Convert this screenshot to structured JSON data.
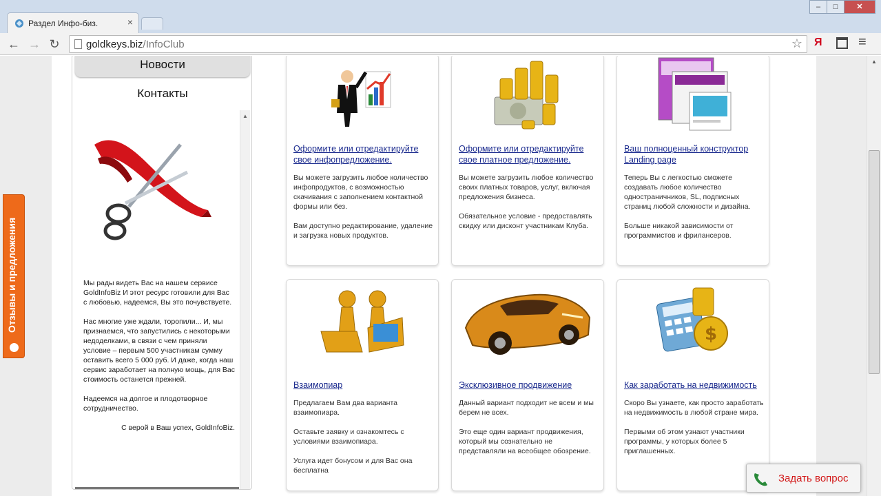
{
  "browser": {
    "tab_title": "Раздел Инфо-биз.",
    "tab_close": "×",
    "url_domain": "goldkeys.biz",
    "url_path": "/InfoClub",
    "back": "←",
    "forward": "→",
    "reload": "↻",
    "star": "☆",
    "yandex": "Я",
    "menu": "≡",
    "minimize": "–",
    "maximize": "□",
    "close": "✕"
  },
  "sidebar": {
    "news": "Новости",
    "contacts": "Контакты",
    "paragraphs": [
      "Мы рады видеть Вас на нашем сервисе GoldInfoBiz И этот ресурс готовили для Вас с любовью, надеемся, Вы это почувствуете.",
      "Нас многие уже ждали, торопили... И, мы признаемся, что запустились с некоторыми недоделками, в связи с чем приняли условие – первым 500 участникам сумму оставить всего 5 000 руб. И даже, когда наш сервис заработает на полную мощь, для Вас стоимость останется прежней.",
      "Надеемся на долгое и плодотворное сотрудничество."
    ],
    "signature": "С верой в Ваш успех, GoldInfoBiz."
  },
  "cards": [
    {
      "title": "Оформите или отредактируйте свое инфопредложение.",
      "paragraphs": [
        "Вы можете загрузить любое количество инфопродуктов, с возможностью скачивания с заполнением контактной формы или без.",
        "Вам доступно редактирование, удаление и загрузка новых продуктов."
      ]
    },
    {
      "title": "Оформите или отредактируйте свое платное предложение.",
      "paragraphs": [
        "Вы можете загрузить любое количество своих платных товаров, услуг, включая предложения бизнеса.",
        "Обязательное условие - предоставлять скидку или дисконт участникам Клуба."
      ]
    },
    {
      "title": "Ваш полноценный конструктор Landing page",
      "paragraphs": [
        "Теперь Вы с легкостью сможете создавать любое количество одностраничников, SL, подписных страниц любой сложности и дизайна.",
        "Больше никакой зависимости от программистов и фрилансеров."
      ]
    },
    {
      "title": "Взаимопиар",
      "paragraphs": [
        "Предлагаем Вам два варианта взаимопиара.",
        "Оставьте заявку и ознакомтесь с условиями взаимопиара.",
        "Услуга идет бонусом и для Вас она бесплатна"
      ]
    },
    {
      "title": "Эксклюзивное продвижение",
      "paragraphs": [
        "Данный вариант подходит не всем и мы берем не всех.",
        "Это еще один вариант продвижения, который мы сознательно не представляли на всеобщее обозрение."
      ]
    },
    {
      "title": "Как заработать на недвижимость",
      "paragraphs": [
        "Скоро Вы узнаете, как просто заработать на недвижимость в любой стране мира.",
        "Первыми об этом узнают участники программы, у которых более 5 приглашенных."
      ]
    }
  ],
  "feedback_tab": "Отзывы и предложения",
  "ask_button": "Задать вопрос",
  "colors": {
    "link": "#1a2a8e",
    "feedback": "#ee6a1a",
    "ask_text": "#d21818"
  },
  "icons": [
    "businessman-chart-icon",
    "gold-coins-money-icon",
    "website-pages-icon",
    "golden-figures-laptops-icon",
    "golden-car-icon",
    "calculator-coins-icon",
    "ribbon-scissors-icon",
    "phone-icon"
  ]
}
